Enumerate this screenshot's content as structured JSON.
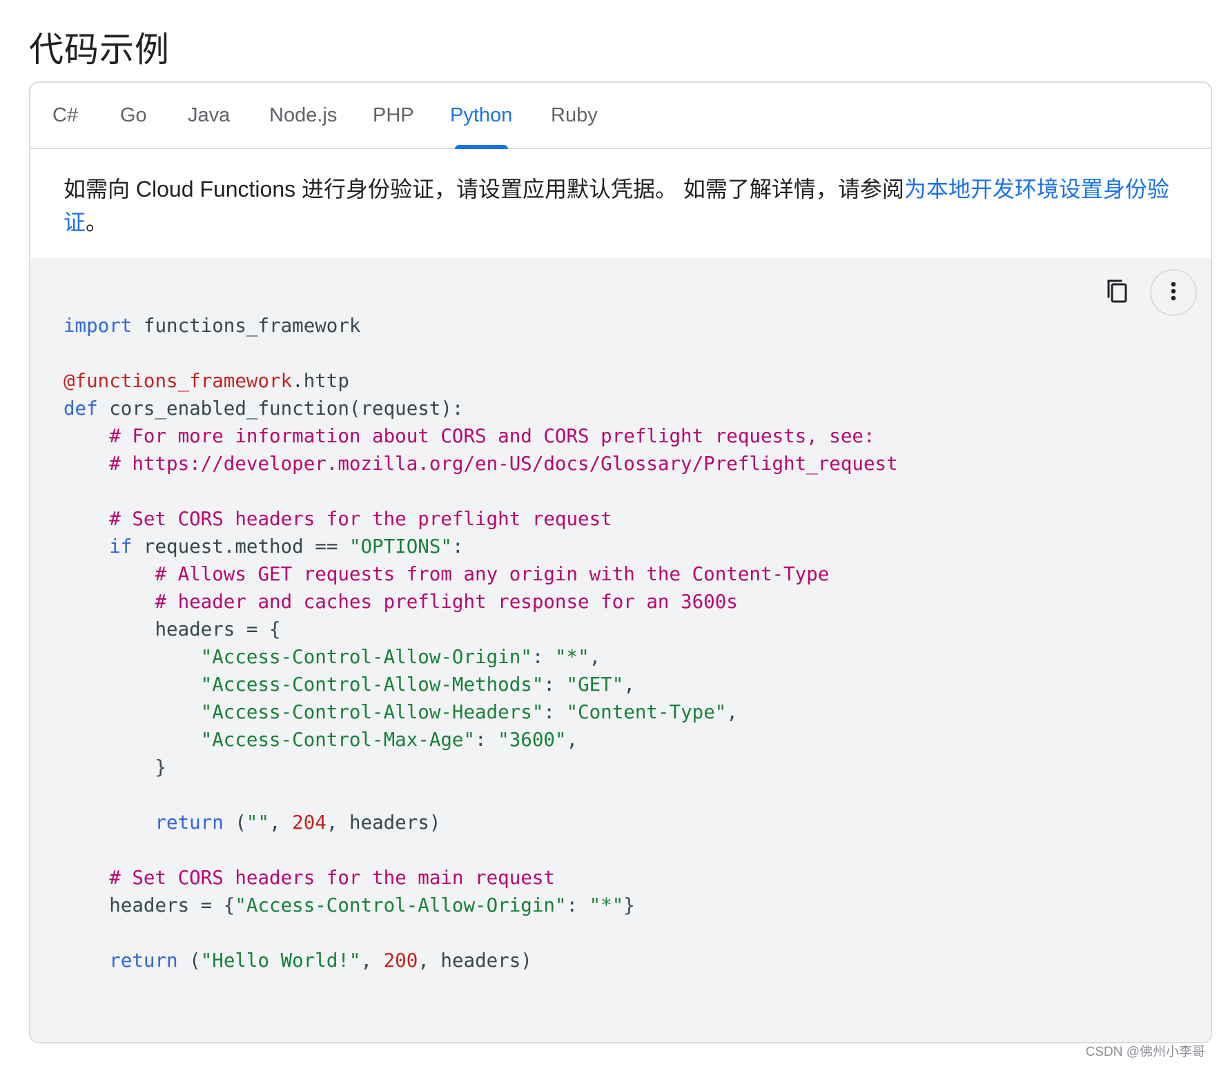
{
  "page": {
    "title": "代码示例"
  },
  "tabs": [
    {
      "label": "C#",
      "active": false
    },
    {
      "label": "Go",
      "active": false
    },
    {
      "label": "Java",
      "active": false
    },
    {
      "label": "Node.js",
      "active": false
    },
    {
      "label": "PHP",
      "active": false
    },
    {
      "label": "Python",
      "active": true
    },
    {
      "label": "Ruby",
      "active": false
    }
  ],
  "intro": {
    "text_before_link": "如需向 Cloud Functions 进行身份验证，请设置应用默认凭据。 如需了解详情，请参阅",
    "link_text": "为本地开发环境设置身份验证",
    "text_after_link": "。"
  },
  "code_toolbar": {
    "copy_icon": "copy-icon",
    "more_icon": "more-vert-icon"
  },
  "code": {
    "language": "python",
    "lines": [
      [
        {
          "t": "kw",
          "v": "import"
        },
        {
          "t": "plain",
          "v": " functions_framework"
        }
      ],
      [],
      [
        {
          "t": "dec",
          "v": "@functions_framework"
        },
        {
          "t": "plain",
          "v": ".http"
        }
      ],
      [
        {
          "t": "kw",
          "v": "def"
        },
        {
          "t": "plain",
          "v": " cors_enabled_function(request):"
        }
      ],
      [
        {
          "t": "plain",
          "v": "    "
        },
        {
          "t": "cm",
          "v": "# For more information about CORS and CORS preflight requests, see:"
        }
      ],
      [
        {
          "t": "plain",
          "v": "    "
        },
        {
          "t": "cm",
          "v": "# https://developer.mozilla.org/en-US/docs/Glossary/Preflight_request"
        }
      ],
      [],
      [
        {
          "t": "plain",
          "v": "    "
        },
        {
          "t": "cm",
          "v": "# Set CORS headers for the preflight request"
        }
      ],
      [
        {
          "t": "plain",
          "v": "    "
        },
        {
          "t": "kw",
          "v": "if"
        },
        {
          "t": "plain",
          "v": " request.method == "
        },
        {
          "t": "str",
          "v": "\"OPTIONS\""
        },
        {
          "t": "plain",
          "v": ":"
        }
      ],
      [
        {
          "t": "plain",
          "v": "        "
        },
        {
          "t": "cm",
          "v": "# Allows GET requests from any origin with the Content-Type"
        }
      ],
      [
        {
          "t": "plain",
          "v": "        "
        },
        {
          "t": "cm",
          "v": "# header and caches preflight response for an 3600s"
        }
      ],
      [
        {
          "t": "plain",
          "v": "        headers = {"
        }
      ],
      [
        {
          "t": "plain",
          "v": "            "
        },
        {
          "t": "str",
          "v": "\"Access-Control-Allow-Origin\""
        },
        {
          "t": "plain",
          "v": ": "
        },
        {
          "t": "str",
          "v": "\"*\""
        },
        {
          "t": "plain",
          "v": ","
        }
      ],
      [
        {
          "t": "plain",
          "v": "            "
        },
        {
          "t": "str",
          "v": "\"Access-Control-Allow-Methods\""
        },
        {
          "t": "plain",
          "v": ": "
        },
        {
          "t": "str",
          "v": "\"GET\""
        },
        {
          "t": "plain",
          "v": ","
        }
      ],
      [
        {
          "t": "plain",
          "v": "            "
        },
        {
          "t": "str",
          "v": "\"Access-Control-Allow-Headers\""
        },
        {
          "t": "plain",
          "v": ": "
        },
        {
          "t": "str",
          "v": "\"Content-Type\""
        },
        {
          "t": "plain",
          "v": ","
        }
      ],
      [
        {
          "t": "plain",
          "v": "            "
        },
        {
          "t": "str",
          "v": "\"Access-Control-Max-Age\""
        },
        {
          "t": "plain",
          "v": ": "
        },
        {
          "t": "str",
          "v": "\"3600\""
        },
        {
          "t": "plain",
          "v": ","
        }
      ],
      [
        {
          "t": "plain",
          "v": "        }"
        }
      ],
      [],
      [
        {
          "t": "plain",
          "v": "        "
        },
        {
          "t": "kw",
          "v": "return"
        },
        {
          "t": "plain",
          "v": " ("
        },
        {
          "t": "str",
          "v": "\"\""
        },
        {
          "t": "plain",
          "v": ", "
        },
        {
          "t": "num",
          "v": "204"
        },
        {
          "t": "plain",
          "v": ", headers)"
        }
      ],
      [],
      [
        {
          "t": "plain",
          "v": "    "
        },
        {
          "t": "cm",
          "v": "# Set CORS headers for the main request"
        }
      ],
      [
        {
          "t": "plain",
          "v": "    headers = {"
        },
        {
          "t": "str",
          "v": "\"Access-Control-Allow-Origin\""
        },
        {
          "t": "plain",
          "v": ": "
        },
        {
          "t": "str",
          "v": "\"*\""
        },
        {
          "t": "plain",
          "v": "}"
        }
      ],
      [],
      [
        {
          "t": "plain",
          "v": "    "
        },
        {
          "t": "kw",
          "v": "return"
        },
        {
          "t": "plain",
          "v": " ("
        },
        {
          "t": "str",
          "v": "\"Hello World!\""
        },
        {
          "t": "plain",
          "v": ", "
        },
        {
          "t": "num",
          "v": "200"
        },
        {
          "t": "plain",
          "v": ", headers)"
        }
      ]
    ]
  },
  "watermark": "CSDN @佛州小李哥",
  "colors": {
    "accent": "#1a73e8",
    "keyword": "#3367d6",
    "decorator": "#c5221f",
    "comment": "#b80672",
    "string": "#188038",
    "number": "#c5221f",
    "code_background": "#f1f3f4",
    "border": "#dadce0"
  }
}
